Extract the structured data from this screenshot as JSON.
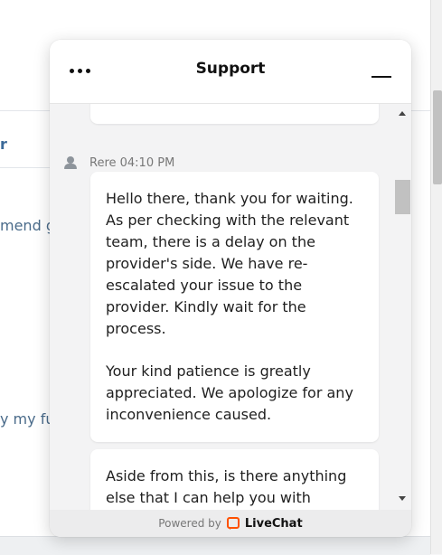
{
  "background": {
    "fragment_1": "r",
    "fragment_2": "mend go",
    "fragment_3": "y my fur"
  },
  "chat": {
    "title": "Support",
    "menu_icon": "more-dots-icon",
    "minimize_icon": "minimize-icon",
    "message": {
      "author": "Rere",
      "time": "04:10 PM",
      "meta": "Rere 04:10 PM",
      "paragraph_1": "Hello there, thank you for waiting. As per checking with the relevant team, there is a delay on the provider's side. We have re-escalated your issue to the provider. Kindly wait for the process.",
      "paragraph_2": "Your kind patience is greatly appreciated. We apologize for any inconvenience caused."
    },
    "next_message": {
      "text": "Aside from this, is there anything else that I can help you with"
    },
    "footer": {
      "powered_by": "Powered by",
      "brand": "LiveChat",
      "brand_color": "#ff5100"
    }
  }
}
